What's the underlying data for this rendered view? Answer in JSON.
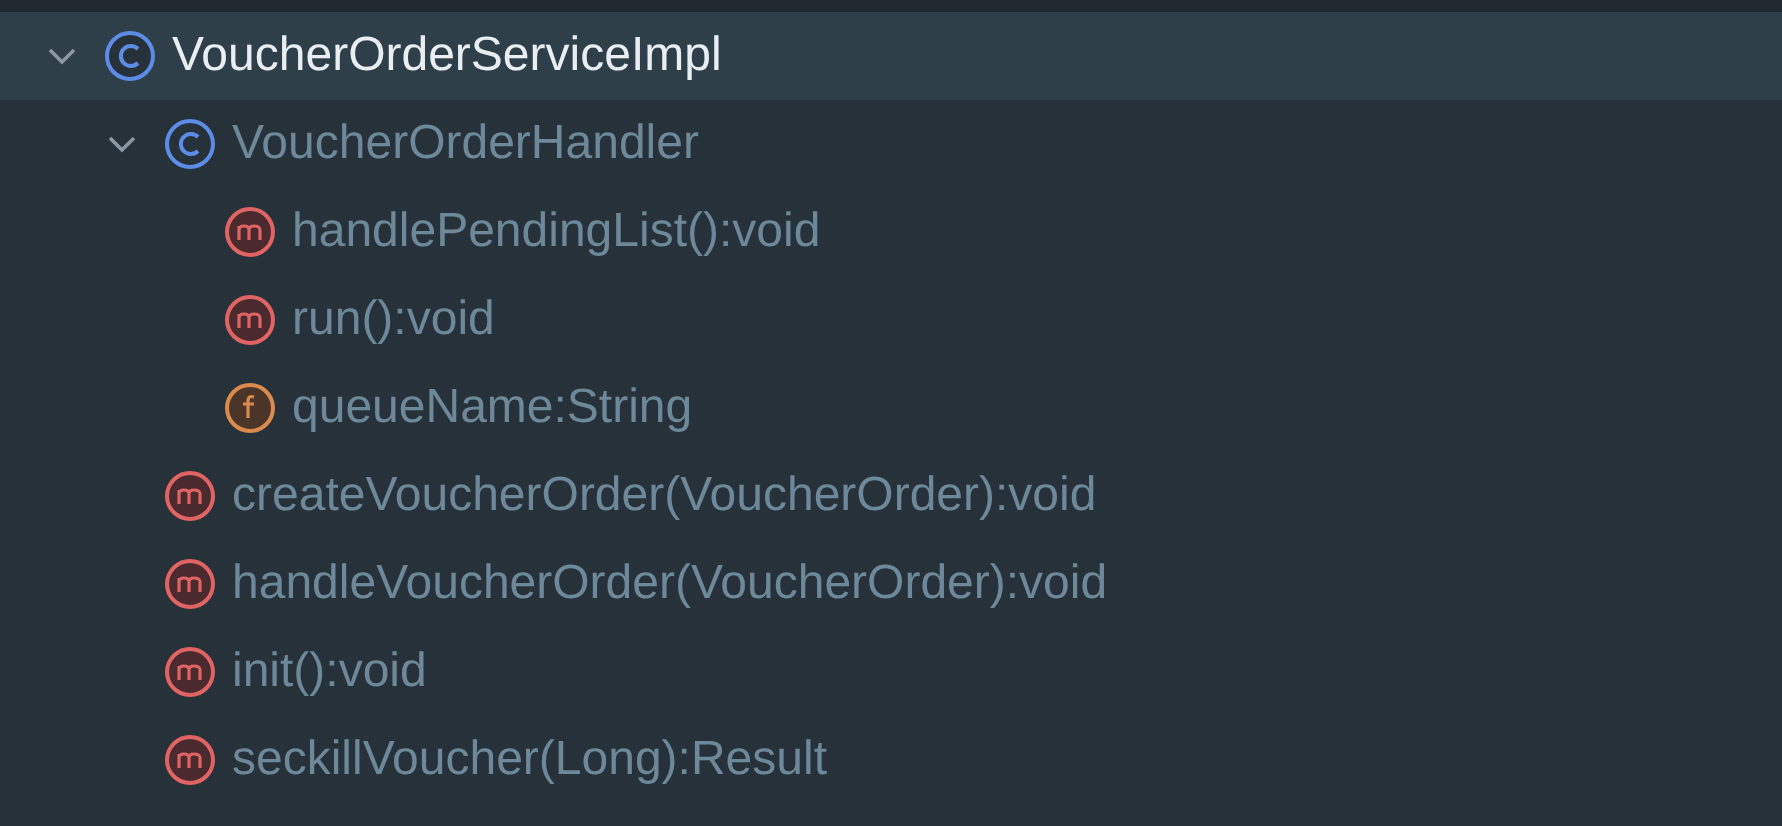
{
  "tree": [
    {
      "kind": "class",
      "name": "VoucherOrderServiceImpl",
      "selected": true,
      "expanded": true,
      "children": [
        {
          "kind": "class",
          "name": "VoucherOrderHandler",
          "selected": false,
          "expanded": true,
          "children": [
            {
              "kind": "method",
              "name": "handlePendingList():void",
              "selected": false
            },
            {
              "kind": "method",
              "name": "run():void",
              "selected": false
            },
            {
              "kind": "field",
              "name": "queueName:String",
              "selected": false
            }
          ]
        },
        {
          "kind": "method",
          "name": "createVoucherOrder(VoucherOrder):void",
          "selected": false
        },
        {
          "kind": "method",
          "name": "handleVoucherOrder(VoucherOrder):void",
          "selected": false
        },
        {
          "kind": "method",
          "name": "init():void",
          "selected": false
        },
        {
          "kind": "method",
          "name": "seckillVoucher(Long):Result",
          "selected": false
        }
      ]
    }
  ]
}
